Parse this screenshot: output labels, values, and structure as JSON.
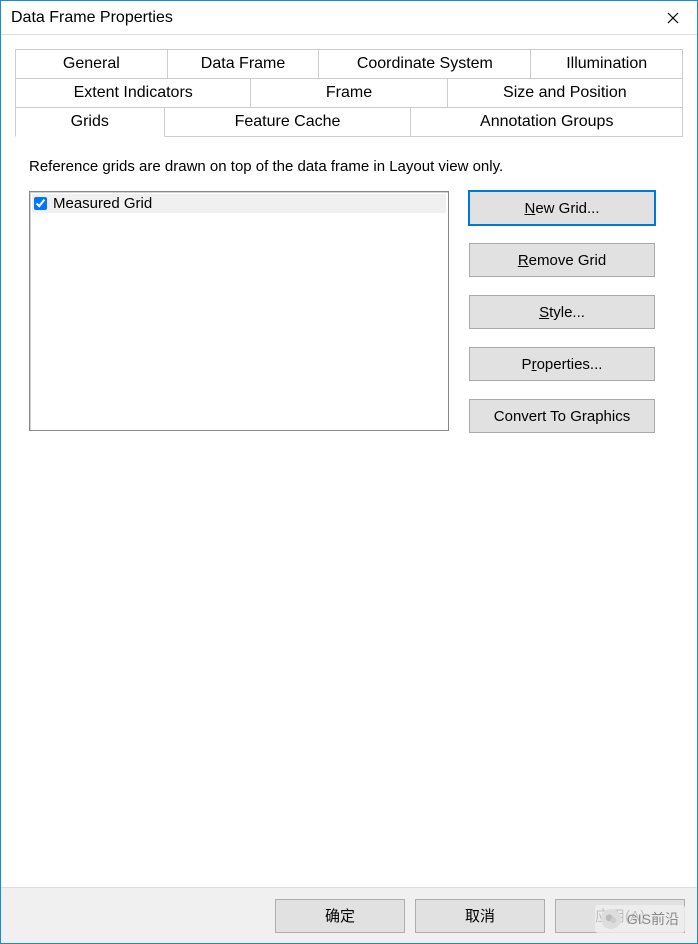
{
  "window": {
    "title": "Data Frame Properties"
  },
  "tabs": {
    "row1": [
      "General",
      "Data Frame",
      "Coordinate System",
      "Illumination"
    ],
    "row2": [
      "Extent Indicators",
      "Frame",
      "Size and Position"
    ],
    "row3": [
      "Grids",
      "Feature Cache",
      "Annotation Groups"
    ],
    "active": "Grids"
  },
  "panel": {
    "description": "Reference grids are drawn on top of the data frame in Layout view only.",
    "grid_list": [
      {
        "label": "Measured Grid",
        "checked": true
      }
    ],
    "buttons": {
      "new_grid_pre": "",
      "new_grid_u": "N",
      "new_grid_post": "ew Grid...",
      "remove_pre": "",
      "remove_u": "R",
      "remove_post": "emove Grid",
      "style_pre": "",
      "style_u": "S",
      "style_post": "tyle...",
      "properties_pre": "P",
      "properties_u": "r",
      "properties_post": "operties...",
      "convert": "Convert To Graphics"
    }
  },
  "footer": {
    "ok": "确定",
    "cancel": "取消",
    "apply": "应用(A)"
  },
  "watermark": {
    "text": "GIS前沿"
  }
}
